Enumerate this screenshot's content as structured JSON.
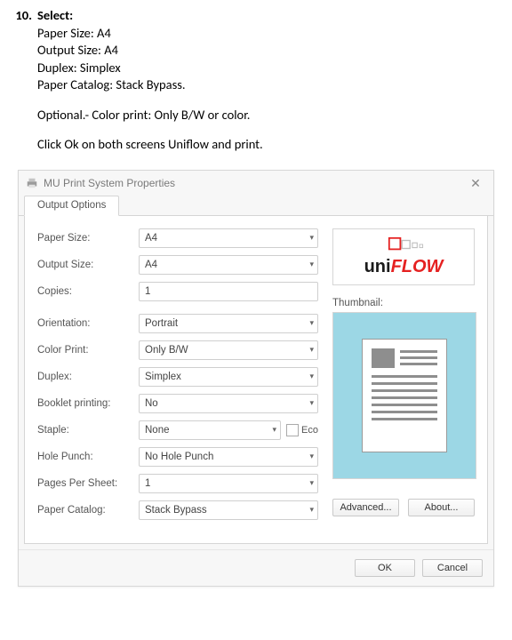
{
  "instructions": {
    "number": "10.",
    "heading": "Select:",
    "lines": [
      "Paper Size: A4",
      "Output Size: A4",
      "Duplex: Simplex",
      "Paper Catalog: Stack Bypass."
    ],
    "optional": "Optional.- Color print: Only B/W or color.",
    "closing": "Click Ok on both screens Uniflow and print."
  },
  "dialog": {
    "title": "MU Print System Properties",
    "tab": "Output Options",
    "options": {
      "paper_size": {
        "label": "Paper Size:",
        "value": "A4",
        "type": "select"
      },
      "output_size": {
        "label": "Output Size:",
        "value": "A4",
        "type": "select"
      },
      "copies": {
        "label": "Copies:",
        "value": "1",
        "type": "input"
      },
      "orientation": {
        "label": "Orientation:",
        "value": "Portrait",
        "type": "select"
      },
      "color_print": {
        "label": "Color Print:",
        "value": "Only B/W",
        "type": "select"
      },
      "duplex": {
        "label": "Duplex:",
        "value": "Simplex",
        "type": "select"
      },
      "booklet_printing": {
        "label": "Booklet printing:",
        "value": "No",
        "type": "select"
      },
      "staple": {
        "label": "Staple:",
        "value": "None",
        "type": "select",
        "eco": true
      },
      "hole_punch": {
        "label": "Hole Punch:",
        "value": "No Hole Punch",
        "type": "select"
      },
      "pages_per_sheet": {
        "label": "Pages Per Sheet:",
        "value": "1",
        "type": "select"
      },
      "paper_catalog": {
        "label": "Paper Catalog:",
        "value": "Stack Bypass",
        "type": "select"
      }
    },
    "eco_label": "Eco",
    "logo": {
      "part1": "uni",
      "part2": "FLOW"
    },
    "thumbnail_label": "Thumbnail:",
    "buttons": {
      "advanced": "Advanced...",
      "about": "About...",
      "ok": "OK",
      "cancel": "Cancel"
    }
  }
}
